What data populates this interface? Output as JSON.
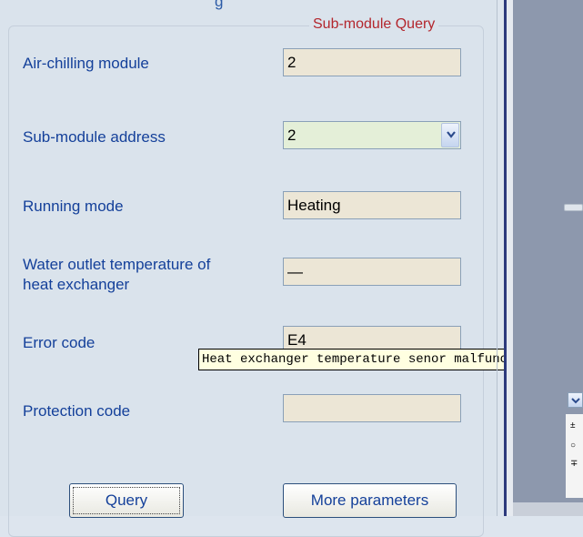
{
  "clipped_heading": "g",
  "groupbox": {
    "title": "Sub-module Query"
  },
  "fields": {
    "air_chilling_module": {
      "label": "Air-chilling module",
      "value": "2"
    },
    "sub_module_address": {
      "label": "Sub-module address",
      "value": "2"
    },
    "running_mode": {
      "label": "Running mode",
      "value": "Heating"
    },
    "water_outlet_temp": {
      "label_line1": "Water outlet temperature of",
      "label_line2": "heat exchanger",
      "value": "—"
    },
    "error_code": {
      "label": "Error code",
      "value": "E4"
    },
    "protection_code": {
      "label": "Protection code",
      "value": ""
    }
  },
  "tooltip": {
    "text": "Heat exchanger temperature senor malfunction"
  },
  "buttons": {
    "query": "Query",
    "more_parameters": "More parameters"
  },
  "side_icons": [
    "±",
    "○",
    "∓"
  ],
  "colors": {
    "label": "#14409a",
    "legend": "#b3262d",
    "field_bg": "#ece6d6",
    "select_bg": "#e4efd8",
    "tooltip_bg": "#ffffe1"
  }
}
